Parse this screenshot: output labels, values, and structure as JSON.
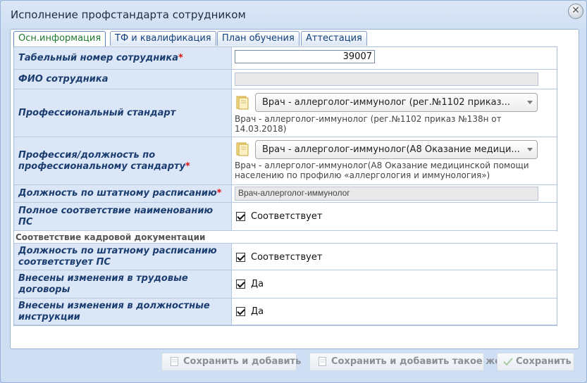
{
  "window": {
    "title": "Исполнение профстандарта сотрудником"
  },
  "tabs": [
    {
      "label": "Осн.информация",
      "active": true
    },
    {
      "label": "ТФ и квалификация",
      "active": false
    },
    {
      "label": "План обучения",
      "active": false
    },
    {
      "label": "Аттестация",
      "active": false
    }
  ],
  "form": {
    "tab_number": {
      "label": "Табельный номер сотрудника",
      "required": "*",
      "value": "39007"
    },
    "full_name": {
      "label": "ФИО сотрудника",
      "value": ""
    },
    "prof_standard": {
      "label": "Профессиональный стандарт",
      "selected": "Врач - аллерголог-иммунолог (рег.№1102 приказ...",
      "description": "Врач - аллерголог-иммунолог (рег.№1102 приказ №138н от 14.03.2018)"
    },
    "profession": {
      "label": "Профессия/должность по профессиональному стандарту",
      "required": "*",
      "selected": "Врач - аллерголог-иммунолог(А8 Оказание медици...",
      "description": "Врач - аллерголог-иммунолог(А8 Оказание медицинской помощи населению по профилю «аллергология и иммунология»)"
    },
    "staff_position": {
      "label": "Должность по штатному расписанию",
      "required": "*",
      "value": "Врач-аллерголог-иммунолог"
    },
    "full_match": {
      "label": "Полное соответствие наименованию ПС",
      "checked": true,
      "text": "Соответствует"
    }
  },
  "hr_section": {
    "title": "Соответствие кадровой документации",
    "rows": [
      {
        "label": "Должность по штатному расписанию соответствует ПС",
        "checked": true,
        "text": "Соответствует"
      },
      {
        "label": "Внесены изменения в трудовые договоры",
        "checked": true,
        "text": "Да"
      },
      {
        "label": "Внесены изменения в должностные инструкции",
        "checked": true,
        "text": "Да"
      }
    ]
  },
  "footer": {
    "save_add": "Сохранить и добавить",
    "save_add_same": "Сохранить и добавить такое же",
    "save": "Сохранить"
  }
}
